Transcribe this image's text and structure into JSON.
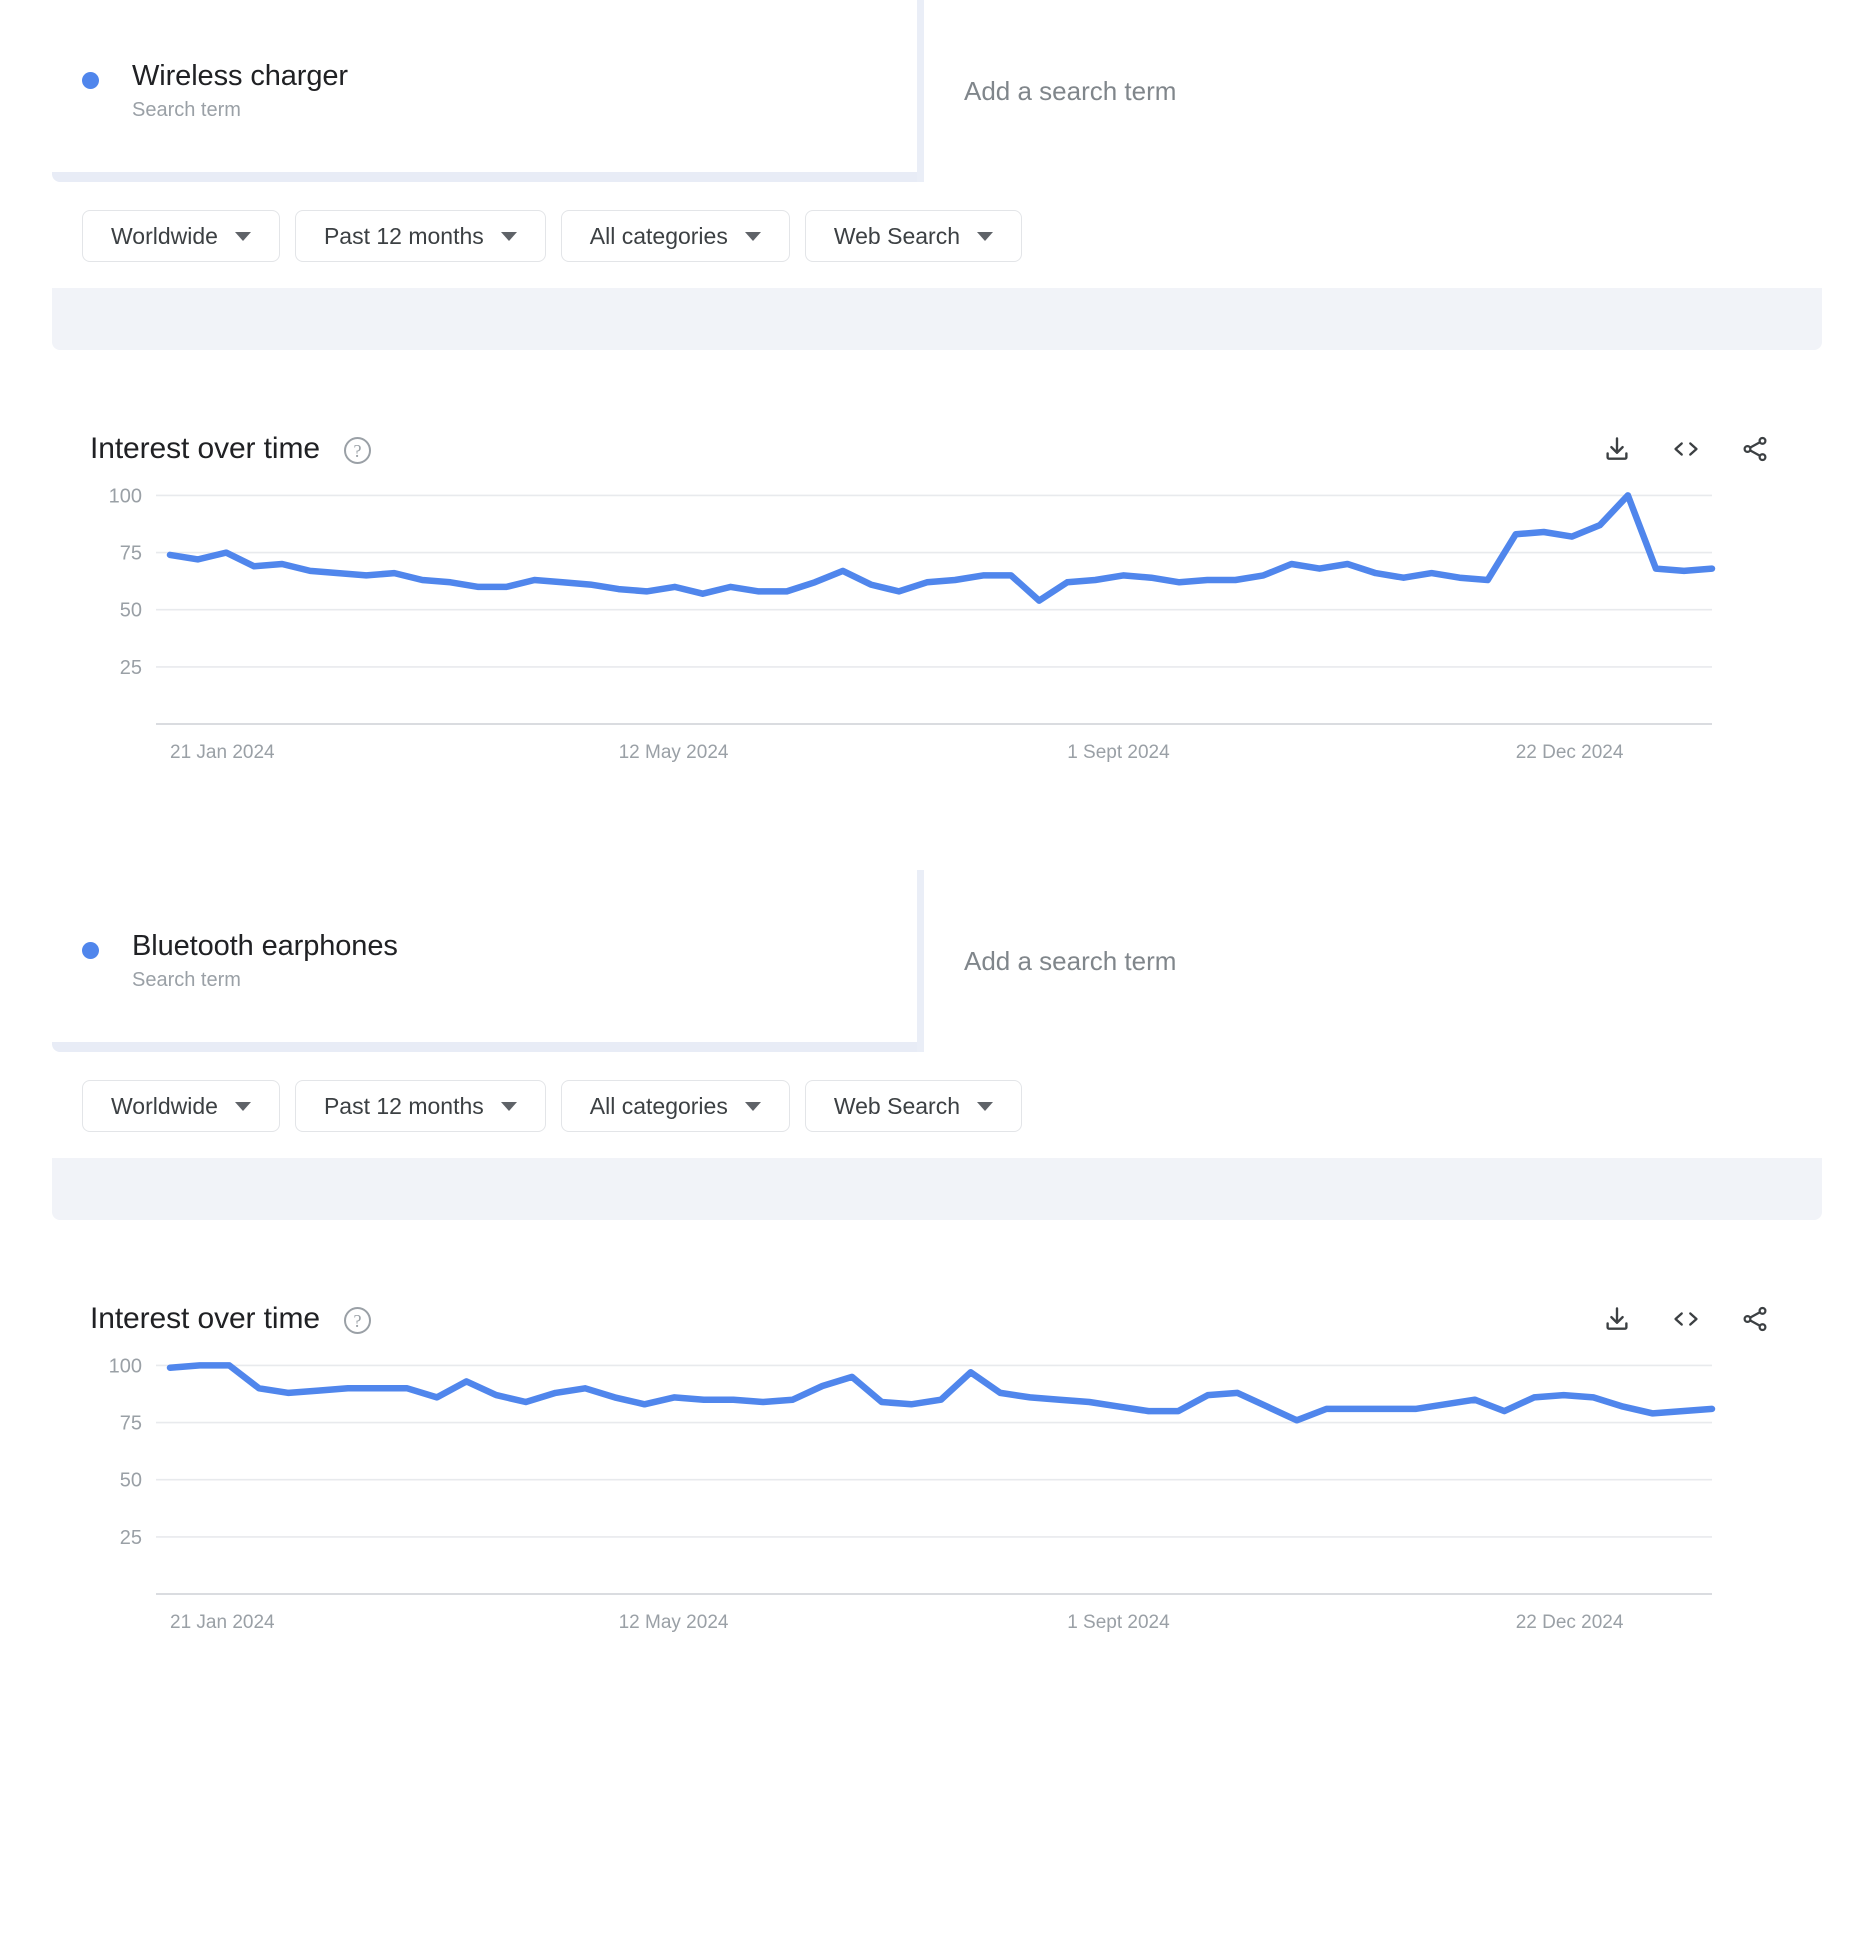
{
  "colors": {
    "accent": "#5086ec",
    "band": "#f1f3f8",
    "underline": "#e8ecf6",
    "text": "#202124",
    "muted": "#9aa0a6"
  },
  "sections": [
    {
      "term": {
        "title": "Wireless charger",
        "subtitle": "Search term",
        "add_placeholder": "Add a search term"
      },
      "filters": [
        {
          "label": "Worldwide"
        },
        {
          "label": "Past 12 months"
        },
        {
          "label": "All categories"
        },
        {
          "label": "Web Search"
        }
      ],
      "chart_header": {
        "title": "Interest over time",
        "help_glyph": "?",
        "actions": [
          {
            "name": "download-icon",
            "title": "Download"
          },
          {
            "name": "embed-icon",
            "title": "Embed"
          },
          {
            "name": "share-icon",
            "title": "Share"
          }
        ]
      }
    },
    {
      "term": {
        "title": "Bluetooth earphones",
        "subtitle": "Search term",
        "add_placeholder": "Add a search term"
      },
      "filters": [
        {
          "label": "Worldwide"
        },
        {
          "label": "Past 12 months"
        },
        {
          "label": "All categories"
        },
        {
          "label": "Web Search"
        }
      ],
      "chart_header": {
        "title": "Interest over time",
        "help_glyph": "?",
        "actions": [
          {
            "name": "download-icon",
            "title": "Download"
          },
          {
            "name": "embed-icon",
            "title": "Embed"
          },
          {
            "name": "share-icon",
            "title": "Share"
          }
        ]
      }
    }
  ],
  "chart_data": [
    {
      "type": "line",
      "title": "Interest over time",
      "series_name": "Wireless charger",
      "xlabel": "",
      "ylabel": "",
      "ylim": [
        0,
        105
      ],
      "yticks": [
        100,
        75,
        50,
        25
      ],
      "xticks": [
        "21 Jan 2024",
        "12 May 2024",
        "1 Sept 2024",
        "22 Dec 2024"
      ],
      "xtick_positions": [
        0,
        16,
        32,
        48
      ],
      "grid": true,
      "legend": "none",
      "color": "#5086ec",
      "x": [
        "21 Jan 2024",
        "28 Jan 2024",
        "4 Feb 2024",
        "11 Feb 2024",
        "18 Feb 2024",
        "25 Feb 2024",
        "3 Mar 2024",
        "10 Mar 2024",
        "17 Mar 2024",
        "24 Mar 2024",
        "31 Mar 2024",
        "7 Apr 2024",
        "14 Apr 2024",
        "21 Apr 2024",
        "28 Apr 2024",
        "5 May 2024",
        "12 May 2024",
        "19 May 2024",
        "26 May 2024",
        "2 Jun 2024",
        "9 Jun 2024",
        "16 Jun 2024",
        "23 Jun 2024",
        "30 Jun 2024",
        "7 Jul 2024",
        "14 Jul 2024",
        "21 Jul 2024",
        "28 Jul 2024",
        "4 Aug 2024",
        "11 Aug 2024",
        "18 Aug 2024",
        "25 Aug 2024",
        "1 Sept 2024",
        "8 Sept 2024",
        "15 Sept 2024",
        "22 Sept 2024",
        "29 Sept 2024",
        "6 Oct 2024",
        "13 Oct 2024",
        "20 Oct 2024",
        "27 Oct 2024",
        "3 Nov 2024",
        "10 Nov 2024",
        "17 Nov 2024",
        "24 Nov 2024",
        "1 Dec 2024",
        "8 Dec 2024",
        "15 Dec 2024",
        "22 Dec 2024",
        "29 Dec 2024",
        "5 Jan 2025",
        "12 Jan 2025"
      ],
      "values": [
        74,
        72,
        75,
        69,
        70,
        67,
        66,
        65,
        66,
        63,
        62,
        60,
        60,
        63,
        62,
        61,
        59,
        58,
        60,
        57,
        60,
        58,
        58,
        62,
        67,
        61,
        58,
        62,
        63,
        65,
        65,
        54,
        62,
        63,
        65,
        64,
        62,
        63,
        63,
        65,
        70,
        68,
        70,
        66,
        64,
        66,
        64,
        63,
        83,
        84,
        82,
        87,
        100,
        68,
        67,
        68
      ]
    },
    {
      "type": "line",
      "title": "Interest over time",
      "series_name": "Bluetooth earphones",
      "xlabel": "",
      "ylabel": "",
      "ylim": [
        0,
        105
      ],
      "yticks": [
        100,
        75,
        50,
        25
      ],
      "xticks": [
        "21 Jan 2024",
        "12 May 2024",
        "1 Sept 2024",
        "22 Dec 2024"
      ],
      "xtick_positions": [
        0,
        16,
        32,
        48
      ],
      "grid": true,
      "legend": "none",
      "color": "#5086ec",
      "x": [
        "21 Jan 2024",
        "28 Jan 2024",
        "4 Feb 2024",
        "11 Feb 2024",
        "18 Feb 2024",
        "25 Feb 2024",
        "3 Mar 2024",
        "10 Mar 2024",
        "17 Mar 2024",
        "24 Mar 2024",
        "31 Mar 2024",
        "7 Apr 2024",
        "14 Apr 2024",
        "21 Apr 2024",
        "28 Apr 2024",
        "5 May 2024",
        "12 May 2024",
        "19 May 2024",
        "26 May 2024",
        "2 Jun 2024",
        "9 Jun 2024",
        "16 Jun 2024",
        "23 Jun 2024",
        "30 Jun 2024",
        "7 Jul 2024",
        "14 Jul 2024",
        "21 Jul 2024",
        "28 Jul 2024",
        "4 Aug 2024",
        "11 Aug 2024",
        "18 Aug 2024",
        "25 Aug 2024",
        "1 Sept 2024",
        "8 Sept 2024",
        "15 Sept 2024",
        "22 Sept 2024",
        "29 Sept 2024",
        "6 Oct 2024",
        "13 Oct 2024",
        "20 Oct 2024",
        "27 Oct 2024",
        "3 Nov 2024",
        "10 Nov 2024",
        "17 Nov 2024",
        "24 Nov 2024",
        "1 Dec 2024",
        "8 Dec 2024",
        "15 Dec 2024",
        "22 Dec 2024",
        "29 Dec 2024",
        "5 Jan 2025",
        "12 Jan 2025"
      ],
      "values": [
        99,
        100,
        100,
        90,
        88,
        89,
        90,
        90,
        90,
        86,
        93,
        87,
        84,
        88,
        90,
        86,
        83,
        86,
        85,
        85,
        84,
        85,
        91,
        95,
        84,
        83,
        85,
        97,
        88,
        86,
        85,
        84,
        82,
        80,
        80,
        87,
        88,
        82,
        76,
        81,
        81,
        81,
        81,
        83,
        85,
        80,
        86,
        87,
        86,
        82,
        79,
        80,
        81
      ]
    }
  ]
}
